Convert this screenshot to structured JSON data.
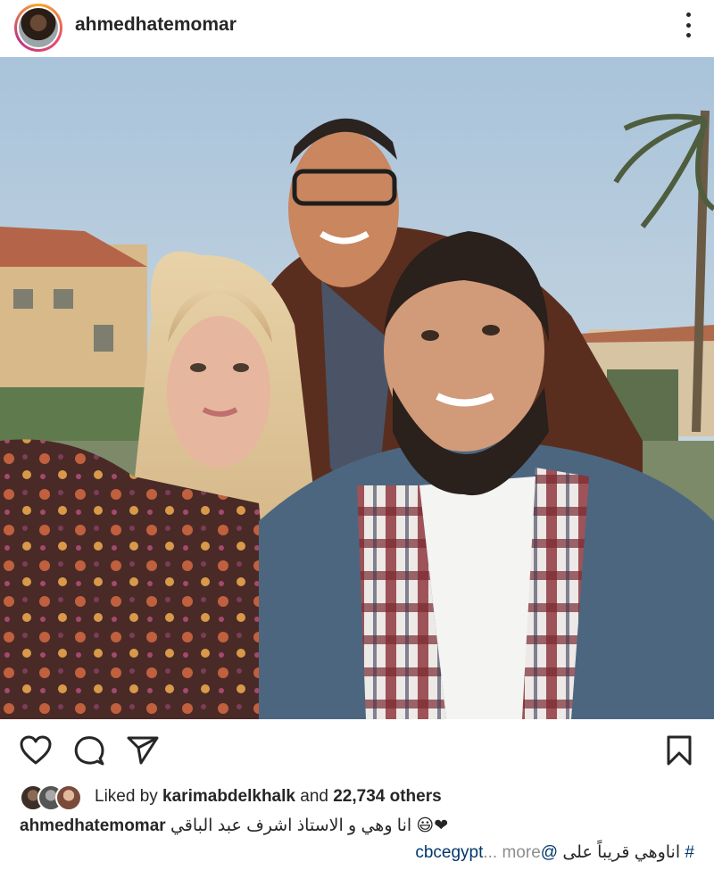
{
  "post": {
    "username": "ahmedhatemomar",
    "likes": {
      "prefix": "Liked by ",
      "first_liker": "karimabdelkhalk",
      "middle": " and ",
      "others": "22,734 others"
    },
    "caption": {
      "username": "ahmedhatemomar",
      "text": "انا وهي و الاستاذ اشرف عبد الباقي 😃❤",
      "mention": "cbcegypt",
      "ellipsis": "... more",
      "at_sign": "@",
      "arabic_tail": "اناوهي قريباً على ",
      "hashtag_mark": "#"
    }
  },
  "icons": {
    "like": "heart-outline-icon",
    "comment": "comment-bubble-icon",
    "share": "paper-plane-icon",
    "save": "bookmark-icon",
    "more": "vertical-ellipsis-icon"
  },
  "colors": {
    "text": "#262626",
    "link": "#00376b",
    "muted": "#8e8e8e",
    "sky": "#b7cde0"
  }
}
